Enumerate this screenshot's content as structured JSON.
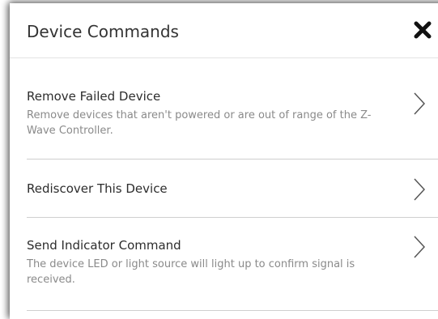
{
  "dialog": {
    "title": "Device Commands"
  },
  "icons": {
    "close": "close-icon",
    "chevron": "chevron-right-icon"
  },
  "colors": {
    "title": "#333333",
    "description": "#8a8a8a",
    "divider": "#cfcfcf"
  },
  "commands": [
    {
      "title": "Remove Failed Device",
      "description": "Remove devices that aren't powered or are out of range of the Z-Wave Controller."
    },
    {
      "title": "Rediscover This Device",
      "description": ""
    },
    {
      "title": "Send Indicator Command",
      "description": "The device LED or light source will light up to confirm signal is received."
    }
  ]
}
